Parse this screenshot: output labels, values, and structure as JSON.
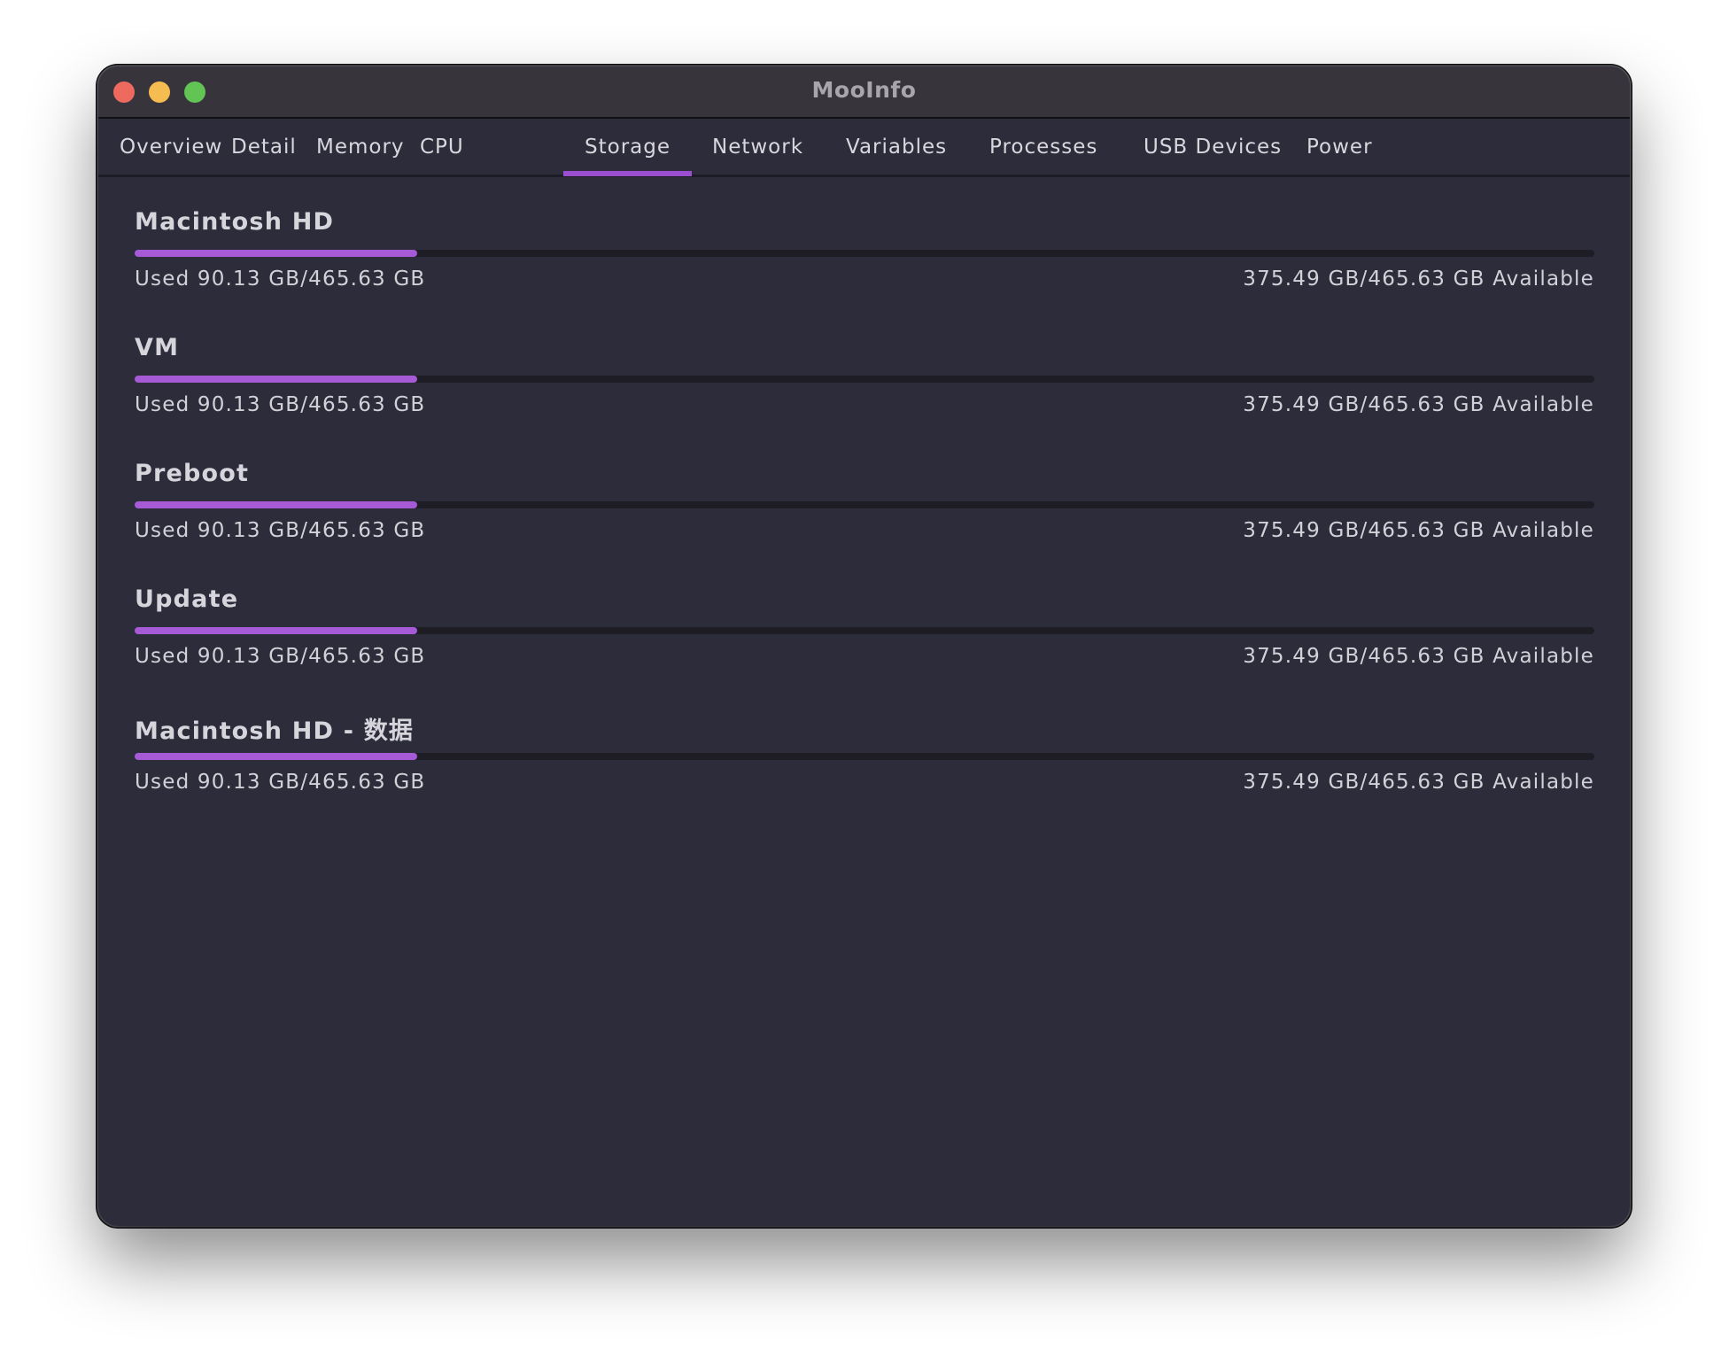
{
  "window": {
    "title": "MooInfo",
    "controls": [
      "close",
      "minimize",
      "zoom"
    ]
  },
  "tabs": [
    {
      "label": "Overview",
      "active": false
    },
    {
      "label": "Detail",
      "active": false
    },
    {
      "label": "Memory",
      "active": false
    },
    {
      "label": "CPU",
      "active": false
    },
    {
      "label": "Storage",
      "active": true
    },
    {
      "label": "Network",
      "active": false
    },
    {
      "label": "Variables",
      "active": false
    },
    {
      "label": "Processes",
      "active": false
    },
    {
      "label": "USB Devices",
      "active": false
    },
    {
      "label": "Power",
      "active": false
    }
  ],
  "colors": {
    "accent": "#9b4fd0",
    "bar_fill": "#a65ad6",
    "bar_track": "#1e1d25",
    "background": "#2d2c3b",
    "titlebar": "#37343b"
  },
  "volumes": [
    {
      "name": "Macintosh HD",
      "used_text": "Used 90.13 GB/465.63 GB",
      "available_text": "375.49 GB/465.63 GB Available",
      "used_fraction": 0.1936
    },
    {
      "name": "VM",
      "used_text": "Used 90.13 GB/465.63 GB",
      "available_text": "375.49 GB/465.63 GB Available",
      "used_fraction": 0.1936
    },
    {
      "name": "Preboot",
      "used_text": "Used 90.13 GB/465.63 GB",
      "available_text": "375.49 GB/465.63 GB Available",
      "used_fraction": 0.1936
    },
    {
      "name": "Update",
      "used_text": "Used 90.13 GB/465.63 GB",
      "available_text": "375.49 GB/465.63 GB Available",
      "used_fraction": 0.1936
    },
    {
      "name": "Macintosh HD - 数据",
      "used_text": "Used 90.13 GB/465.63 GB",
      "available_text": "375.49 GB/465.63 GB Available",
      "used_fraction": 0.1936
    }
  ]
}
